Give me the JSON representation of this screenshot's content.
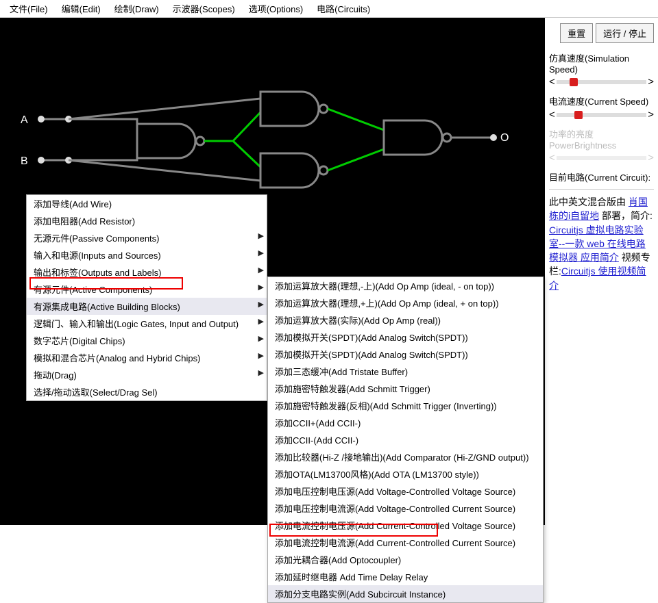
{
  "menubar": {
    "file": "文件(File)",
    "edit": "编辑(Edit)",
    "draw": "绘制(Draw)",
    "scopes": "示波器(Scopes)",
    "options": "选项(Options)",
    "circuits": "电路(Circuits)"
  },
  "buttons": {
    "reset": "重置",
    "runstop": "运行 / 停止"
  },
  "sliders": {
    "simspeed": {
      "label": "仿真速度(Simulation Speed)",
      "pos": 15
    },
    "curspeed": {
      "label": "电流速度(Current Speed)",
      "pos": 20
    },
    "power": {
      "label": "功率的亮度PowerBrightness",
      "pos": 50
    }
  },
  "current_circuit_label": "目前电路(Current Circuit):",
  "credits": {
    "t1": "此中英文混合版由 ",
    "link1": "肖国栋的i自留地",
    "t2": " 部署，简介: ",
    "link2": "Circuitjs 虚拟电路实验室--一款 web 在线电路模拟器 应用简介",
    "t3": " 视频专栏:",
    "link3": "Circuitjs 使用视频简介"
  },
  "ctx1": {
    "add_wire": "添加导线(Add Wire)",
    "add_resistor": "添加电阻器(Add Resistor)",
    "passive": "无源元件(Passive Components)",
    "inputs": "输入和电源(Inputs and Sources)",
    "outputs": "输出和标签(Outputs and Labels)",
    "active_comp": "有源元件(Active Components)",
    "active_blocks": "有源集成电路(Active Building Blocks)",
    "logic": "逻辑门、输入和输出(Logic Gates, Input and Output)",
    "digital": "数字芯片(Digital Chips)",
    "analog": "模拟和混合芯片(Analog and Hybrid Chips)",
    "drag": "拖动(Drag)",
    "select": "选择/拖动选取(Select/Drag Sel)"
  },
  "ctx2": {
    "op_ideal_neg": "添加运算放大器(理想,-上)(Add Op Amp (ideal, - on top))",
    "op_ideal_pos": "添加运算放大器(理想,+上)(Add Op Amp (ideal, + on top))",
    "op_real": "添加运算放大器(实际)(Add Op Amp (real))",
    "analog_sw1": "添加模拟开关(SPDT)(Add Analog Switch(SPDT))",
    "analog_sw2": "添加模拟开关(SPDT)(Add Analog Switch(SPDT))",
    "tristate": "添加三态缓冲(Add Tristate Buffer)",
    "schmitt": "添加施密特触发器(Add Schmitt Trigger)",
    "schmitt_inv": "添加施密特触发器(反相)(Add Schmitt Trigger (Inverting))",
    "ccii_plus": "添加CCII+(Add CCII-)",
    "ccii_minus": "添加CCII-(Add CCII-)",
    "comparator": "添加比较器(Hi-Z /接地输出)(Add Comparator (Hi-Z/GND output))",
    "ota": "添加OTA(LM13700风格)(Add OTA (LM13700 style))",
    "vcvs": "添加电压控制电压源(Add Voltage-Controlled Voltage Source)",
    "vccs": "添加电压控制电流源(Add Voltage-Controlled Current Source)",
    "ccvs": "添加电流控制电压源(Add Current-Controlled Voltage Source)",
    "cccs": "添加电流控制电流源(Add Current-Controlled Current Source)",
    "opto": "添加光耦合器(Add Optocoupler)",
    "timedelay": "添加延时继电器 Add Time Delay Relay",
    "subcircuit": "添加分支电路实例(Add Subcircuit Instance)"
  },
  "circuit": {
    "label_a": "A",
    "label_b": "B",
    "label_o": "O"
  }
}
